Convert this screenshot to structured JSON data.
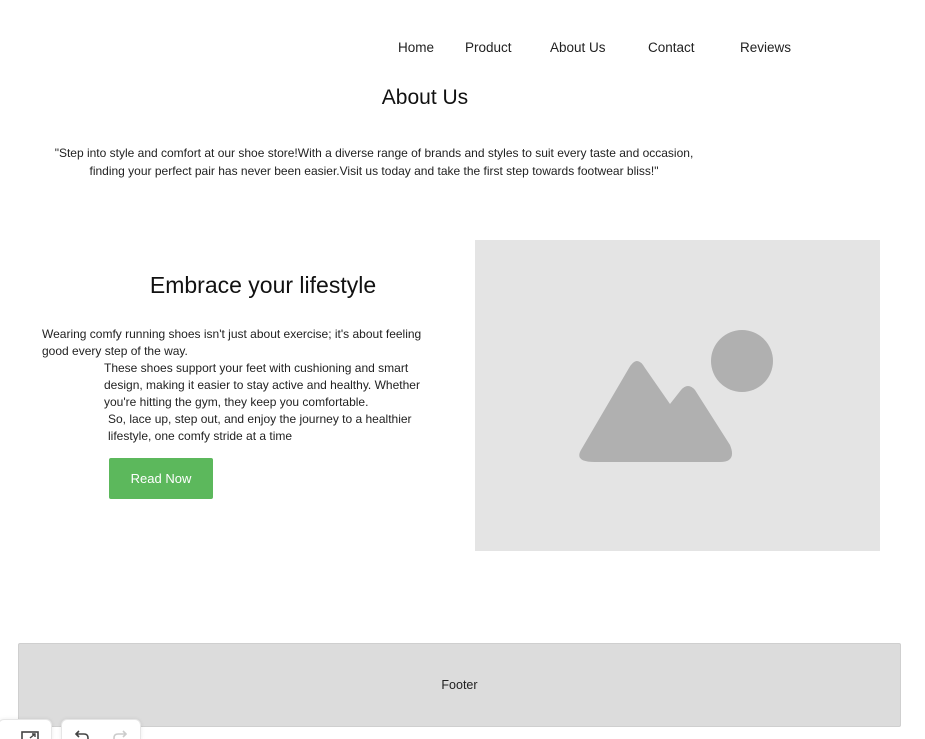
{
  "nav": {
    "items": [
      {
        "label": "Home"
      },
      {
        "label": "Product"
      },
      {
        "label": "About Us"
      },
      {
        "label": "Contact"
      },
      {
        "label": "Reviews"
      }
    ]
  },
  "page": {
    "title": "About Us",
    "intro_line1": "\"Step into style and comfort at our shoe store!With a diverse range of brands and styles to suit every taste and occasion,",
    "intro_line2": "finding your perfect pair has never been easier.Visit us today and take the first step towards footwear bliss!\""
  },
  "hero": {
    "title": "Embrace your lifestyle",
    "paragraph1": "Wearing comfy running shoes isn't just about exercise; it's about feeling good every step of the way.",
    "paragraph2": "These shoes support your feet with cushioning and smart design, making it easier to stay active and healthy. Whether you're hitting the gym, they keep you comfortable.",
    "paragraph3": "So, lace up, step out, and enjoy the journey to a healthier lifestyle, one comfy stride at a time",
    "button_label": "Read Now",
    "image_icon": "image-placeholder-icon"
  },
  "footer": {
    "label": "Footer"
  },
  "toolbar": {
    "icons": [
      "resize-icon",
      "undo-icon",
      "redo-icon"
    ]
  },
  "colors": {
    "button": "#5cb85c",
    "image_bg": "#e4e4e4",
    "image_icon": "#b0b0b0",
    "footer_bg": "#dcdcdc"
  }
}
